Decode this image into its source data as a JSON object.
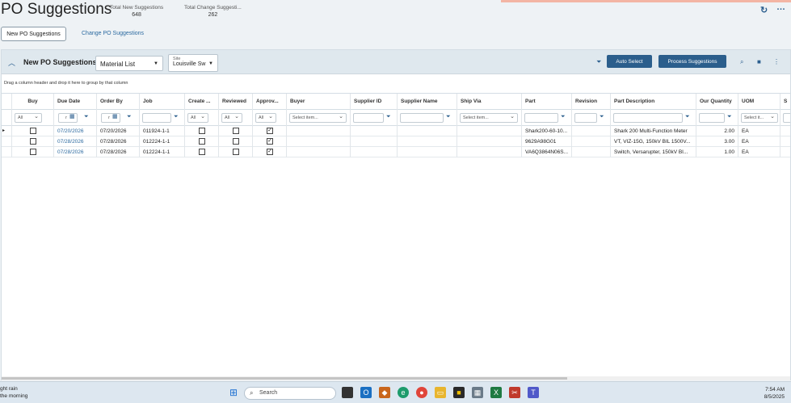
{
  "header": {
    "title": "PO Suggestions",
    "stats": [
      {
        "label": "Total New Suggestions",
        "value": "648"
      },
      {
        "label": "Total Change Suggesti...",
        "value": "262"
      }
    ],
    "refresh_icon": "refresh-icon",
    "more_icon": "more-icon"
  },
  "tabs": [
    {
      "label": "New PO Suggestions"
    },
    {
      "label": "Change PO Suggestions"
    }
  ],
  "panel": {
    "title": "New PO Suggestions",
    "view_select": "Material List",
    "site_label": "Site",
    "site_value": "Louisville Sw",
    "auto_select": "Auto Select",
    "process": "Process Suggestions",
    "group_hint": "Drag a column header and drop it here to group by that column"
  },
  "columns": [
    "Buy",
    "Due Date",
    "Order By",
    "Job",
    "Create ...",
    "Reviewed",
    "Approv...",
    "Buyer",
    "Supplier ID",
    "Supplier Name",
    "Ship Via",
    "Part",
    "Revision",
    "Part Description",
    "Our Quantity",
    "UOM",
    "S"
  ],
  "filters": {
    "buy": "All",
    "create": "All",
    "reviewed": "All",
    "approved": "All",
    "buyer": "Select item...",
    "shipvia": "Select item...",
    "uom": "Select it...",
    "date_r": "r"
  },
  "rows": [
    {
      "due": "07/20/2026",
      "order_by": "07/20/2026",
      "job": "011924-1-1",
      "part": "Shark200-60-10...",
      "desc": "Shark 200 Multi-Function Meter",
      "qty": "2.00",
      "uom": "EA"
    },
    {
      "due": "07/28/2026",
      "order_by": "07/28/2026",
      "job": "012224-1-1",
      "part": "9629A98G01",
      "desc": "VT, VIZ-15G, 150kV BIL 1500V...",
      "qty": "3.00",
      "uom": "EA"
    },
    {
      "due": "07/28/2026",
      "order_by": "07/28/2026",
      "job": "012224-1-1",
      "part": "VA6Q3864N06S...",
      "desc": "Switch, Versarupter, 150kV BI...",
      "qty": "1.00",
      "uom": "EA"
    }
  ],
  "taskbar": {
    "weather_line1": "ght rain",
    "weather_line2": "the morning",
    "search": "Search",
    "time": "7:54 AM",
    "date": "8/5/2025"
  }
}
